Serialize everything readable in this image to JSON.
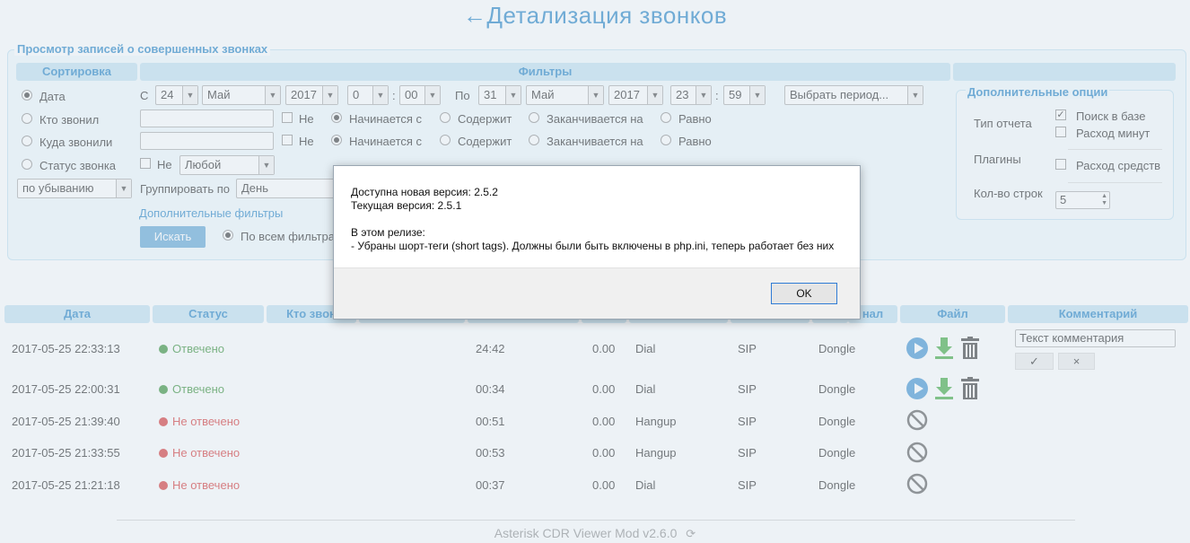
{
  "page": {
    "title": "←Детализация звонков"
  },
  "search_panel": {
    "legend": "Просмотр записей о совершенных звонках",
    "sort_header": "Сортировка",
    "filters_header": "Фильтры",
    "sort_options": [
      "Дата",
      "Кто звонил",
      "Куда звонили",
      "Статус звонка"
    ],
    "sort_selected": "Дата",
    "order": "по убыванию",
    "date_from_label": "С",
    "date_from": {
      "day": "24",
      "month": "Май",
      "year": "2017",
      "hour": "0",
      "minute": "00"
    },
    "date_to_label": "По",
    "date_to": {
      "day": "31",
      "month": "Май",
      "year": "2017",
      "hour": "23",
      "minute": "59"
    },
    "time_separator": ":",
    "period_select": "Выбрать период...",
    "not_label": "Не",
    "match_options": [
      "Начинается с",
      "Содержит",
      "Заканчивается на",
      "Равно"
    ],
    "status_select": "Любой",
    "group_by_label": "Группировать по",
    "group_by_value": "День",
    "extra_filters_link": "Дополнительные фильтры",
    "search_button": "Искать",
    "all_filters_label": "По всем фильтра"
  },
  "options_panel": {
    "title": "Дополнительные опции",
    "report_type_label": "Тип отчета",
    "search_db_label": "Поиск в базе",
    "search_db_checked": true,
    "minutes_label": "Расход минут",
    "minutes_checked": false,
    "plugins_label": "Плагины",
    "funds_label": "Расход средств",
    "funds_checked": false,
    "rows_label": "Кол-во строк",
    "rows_value": "5"
  },
  "table": {
    "headers": [
      "Дата",
      "Статус",
      "Кто звон",
      "",
      "",
      "",
      "",
      "",
      "",
      "нал",
      "Файл",
      "Комментарий"
    ],
    "rows": [
      {
        "date": "2017-05-25 22:33:13",
        "status": "Отвечено",
        "answered": true,
        "duration": "24:42",
        "cost": "0.00",
        "app": "Dial",
        "proto": "SIP",
        "channel": "Dongle",
        "has_file": true
      },
      {
        "date": "2017-05-25 22:00:31",
        "status": "Отвечено",
        "answered": true,
        "duration": "00:34",
        "cost": "0.00",
        "app": "Dial",
        "proto": "SIP",
        "channel": "Dongle",
        "has_file": true
      },
      {
        "date": "2017-05-25 21:39:40",
        "status": "Не отвечено",
        "answered": false,
        "duration": "00:51",
        "cost": "0.00",
        "app": "Hangup",
        "proto": "SIP",
        "channel": "Dongle",
        "has_file": false
      },
      {
        "date": "2017-05-25 21:33:55",
        "status": "Не отвечено",
        "answered": false,
        "duration": "00:53",
        "cost": "0.00",
        "app": "Hangup",
        "proto": "SIP",
        "channel": "Dongle",
        "has_file": false
      },
      {
        "date": "2017-05-25 21:21:18",
        "status": "Не отвечено",
        "answered": false,
        "duration": "00:37",
        "cost": "0.00",
        "app": "Dial",
        "proto": "SIP",
        "channel": "Dongle",
        "has_file": false
      }
    ],
    "comment_value": "Текст комментария",
    "comment_save": "✓",
    "comment_cancel": "×"
  },
  "dialog": {
    "line1": "Доступна новая версия: 2.5.2",
    "line2": "Текущая версия: 2.5.1",
    "line3": "В этом релизе:",
    "line4": "- Убраны шорт-теги (short tags). Должны были быть включены в php.ini, теперь работает без них",
    "ok": "OK"
  },
  "footer": {
    "text": "Asterisk CDR Viewer Mod v2.6.0",
    "icon": "refresh-icon"
  },
  "colors": {
    "accent": "#1d7fc3",
    "header_bg": "#bfe0f0",
    "answered": "#2e8b2e",
    "not_answered": "#d62d2d",
    "play_icon": "#3a8fd0",
    "download_icon": "#3aa63a"
  }
}
